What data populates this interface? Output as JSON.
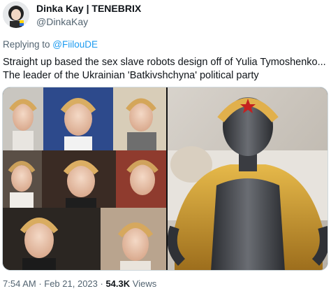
{
  "author": {
    "display_name": "Dinka Kay | TENEBRIX",
    "handle": "@DinkaKay"
  },
  "reply": {
    "prefix": "Replying to ",
    "mention": "@FiilouDE"
  },
  "tweet": {
    "line1": "Straight up based the sex slave robots design off of Yulia Tymoshenko...",
    "line2": "The leader of the Ukrainian 'Batkivshchyna' political party"
  },
  "media": {
    "left_image": "photo-collage-portraits",
    "right_image": "robot-figure-golden-braid"
  },
  "footer": {
    "time": "7:54 AM",
    "separator1": " · ",
    "date": "Feb 21, 2023",
    "separator2": " · ",
    "views_count": "54.3K",
    "views_label": " Views"
  },
  "colors": {
    "text_primary": "#0f1419",
    "text_secondary": "#536471",
    "link": "#1d9bf0",
    "border": "#cfd9de"
  }
}
